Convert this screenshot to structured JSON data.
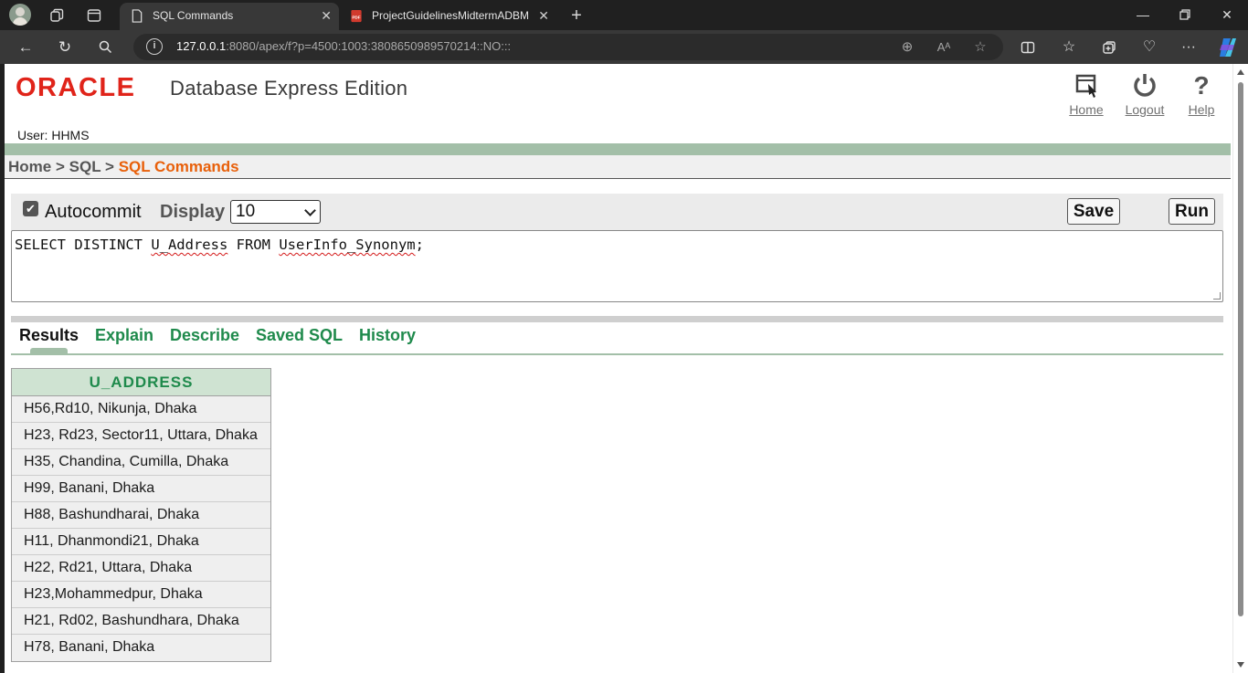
{
  "browser": {
    "tabs": [
      {
        "title": "SQL Commands",
        "active": true
      },
      {
        "title": "ProjectGuidelinesMidtermADBM",
        "active": false
      }
    ],
    "url": {
      "host": "127.0.0.1",
      "rest": ":8080/apex/f?p=4500:1003:3808650989570214::NO:::"
    }
  },
  "header": {
    "logo_text": "ORACLE",
    "product": "Database Express Edition",
    "links": [
      {
        "label": "Home",
        "icon": "home-icon"
      },
      {
        "label": "Logout",
        "icon": "power-icon"
      },
      {
        "label": "Help",
        "icon": "help-icon"
      }
    ],
    "user": "User: HHMS"
  },
  "breadcrumb": {
    "home": "Home",
    "sep1": ">",
    "sql": "SQL",
    "sep2": ">",
    "current": "SQL Commands"
  },
  "toolbar": {
    "autocommit_label": "Autocommit",
    "autocommit_checked": true,
    "display_label": "Display",
    "display_value": "10",
    "save_label": "Save",
    "run_label": "Run"
  },
  "editor": {
    "tok1": "SELECT DISTINCT ",
    "tok2": "U_Address",
    "tok3": " FROM ",
    "tok4": "UserInfo_Synonym",
    "tok5": ";"
  },
  "result_tabs": [
    "Results",
    "Explain",
    "Describe",
    "Saved SQL",
    "History"
  ],
  "results": {
    "column": "U_ADDRESS",
    "rows": [
      "H56,Rd10, Nikunja, Dhaka",
      "H23, Rd23, Sector11, Uttara, Dhaka",
      "H35, Chandina, Cumilla, Dhaka",
      "H99, Banani, Dhaka",
      "H88, Bashundharai, Dhaka",
      "H11, Dhanmondi21, Dhaka",
      "H22, Rd21, Uttara, Dhaka",
      "H23,Mohammedpur, Dhaka",
      "H21, Rd02, Bashundhara, Dhaka",
      "H78, Banani, Dhaka"
    ]
  },
  "colors": {
    "oracle_red": "#e0241a",
    "accent_orange": "#e8600a",
    "link_green": "#1f8a4c",
    "band_green": "#a3bfa8"
  }
}
